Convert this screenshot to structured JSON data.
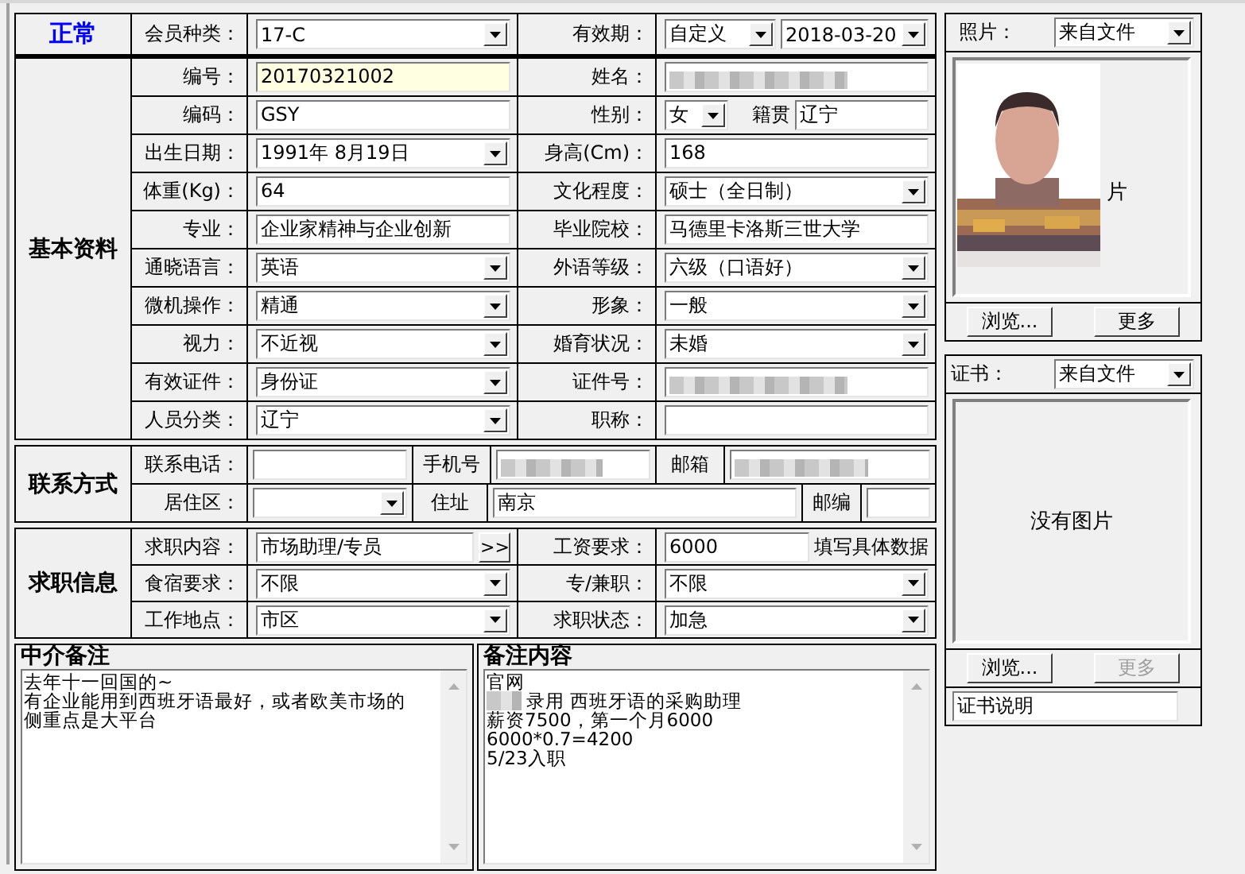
{
  "status": "正常",
  "member_type": {
    "label": "会员种类：",
    "value": "17-C"
  },
  "validity": {
    "label": "有效期：",
    "mode": "自定义",
    "date": "2018-03-20"
  },
  "basic": {
    "title": "基本资料",
    "rows": [
      {
        "left": {
          "label": "编号：",
          "kind": "text",
          "value": "20170321002",
          "highlighted": true
        },
        "right": {
          "label": "姓名：",
          "kind": "redacted"
        }
      },
      {
        "left": {
          "label": "编码：",
          "kind": "text",
          "value": "GSY"
        },
        "right": {
          "label": "性别：",
          "kind": "sex",
          "value": "女",
          "extra_label": "籍贯",
          "extra_value": "辽宁"
        }
      },
      {
        "left": {
          "label": "出生日期：",
          "kind": "select",
          "value": "1991年 8月19日"
        },
        "right": {
          "label": "身高(Cm)：",
          "kind": "text",
          "value": "168"
        }
      },
      {
        "left": {
          "label": "体重(Kg)：",
          "kind": "text",
          "value": "64"
        },
        "right": {
          "label": "文化程度：",
          "kind": "select",
          "value": "硕士（全日制）"
        }
      },
      {
        "left": {
          "label": "专业：",
          "kind": "text",
          "value": "企业家精神与企业创新"
        },
        "right": {
          "label": "毕业院校：",
          "kind": "text",
          "value": "马德里卡洛斯三世大学"
        }
      },
      {
        "left": {
          "label": "通晓语言：",
          "kind": "select",
          "value": "英语"
        },
        "right": {
          "label": "外语等级：",
          "kind": "select",
          "value": "六级（口语好）"
        }
      },
      {
        "left": {
          "label": "微机操作：",
          "kind": "select",
          "value": "精通"
        },
        "right": {
          "label": "形象：",
          "kind": "select",
          "value": "一般"
        }
      },
      {
        "left": {
          "label": "视力：",
          "kind": "select",
          "value": "不近视"
        },
        "right": {
          "label": "婚育状况：",
          "kind": "select",
          "value": "未婚"
        }
      },
      {
        "left": {
          "label": "有效证件：",
          "kind": "select",
          "value": "身份证"
        },
        "right": {
          "label": "证件号：",
          "kind": "redacted"
        }
      },
      {
        "left": {
          "label": "人员分类：",
          "kind": "select",
          "value": "辽宁"
        },
        "right": {
          "label": "职称：",
          "kind": "text"
        }
      }
    ]
  },
  "contact": {
    "title": "联系方式",
    "rows": [
      [
        {
          "label": "联系电话：",
          "kind": "text"
        },
        {
          "label": "手机号",
          "kind": "redacted"
        },
        {
          "label": "邮箱",
          "kind": "redacted"
        }
      ],
      [
        {
          "label": "居住区：",
          "kind": "select"
        },
        {
          "label": "住址",
          "kind": "text",
          "value": "南京"
        },
        {
          "label": "邮编",
          "kind": "text"
        }
      ]
    ]
  },
  "job": {
    "title": "求职信息",
    "rows": [
      {
        "left": {
          "label": "求职内容：",
          "kind": "more",
          "value": "市场助理/专员",
          "button": ">>"
        },
        "right": {
          "label": "工资要求：",
          "kind": "hint",
          "value": "6000",
          "hint": "填写具体数据"
        }
      },
      {
        "left": {
          "label": "食宿要求：",
          "kind": "select",
          "value": "不限"
        },
        "right": {
          "label": "专/兼职：",
          "kind": "select",
          "value": "不限"
        }
      },
      {
        "left": {
          "label": "工作地点：",
          "kind": "select",
          "value": "市区"
        },
        "right": {
          "label": "求职状态：",
          "kind": "select",
          "value": "加急"
        }
      }
    ]
  },
  "notes": [
    {
      "title": "中介备注",
      "lines": [
        {
          "text": "去年十一回国的~"
        },
        {
          "text": "有企业能用到西班牙语最好，或者欧美市场的"
        },
        {
          "text": "侧重点是大平台"
        }
      ]
    },
    {
      "title": "备注内容",
      "lines": [
        {
          "text": "官网"
        },
        {
          "text": "录用 西班牙语的采购助理",
          "redacted_prefix": true
        },
        {
          "text": "薪资7500，第一个月6000"
        },
        {
          "text": "6000*0.7=4200"
        },
        {
          "text": "5/23入职"
        }
      ]
    }
  ],
  "photo": {
    "label": "照片：",
    "source": "来自文件",
    "kind": "picture",
    "caption_visible": "片",
    "buttons": [
      {
        "label": "浏览...",
        "disabled": false
      },
      {
        "label": "更多",
        "disabled": false
      }
    ]
  },
  "cert": {
    "label": "证书：",
    "source": "来自文件",
    "empty_text": "没有图片",
    "buttons": [
      {
        "label": "浏览...",
        "disabled": false
      },
      {
        "label": "更多",
        "disabled": true
      }
    ],
    "caption": "证书说明"
  }
}
